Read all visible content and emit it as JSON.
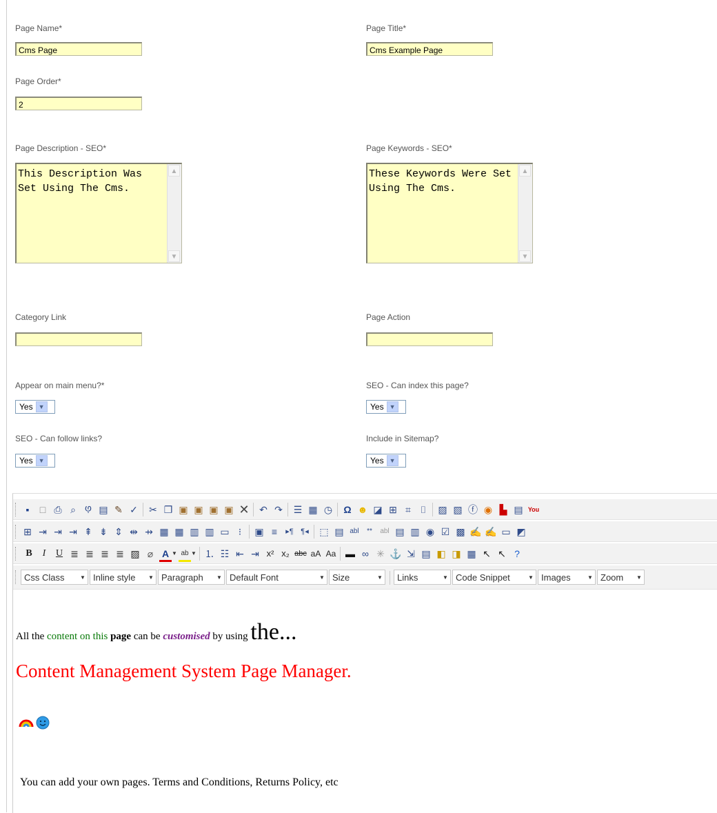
{
  "form": {
    "page_name": {
      "label": "Page Name*",
      "value": "Cms Page"
    },
    "page_title": {
      "label": "Page Title*",
      "value": "Cms Example Page"
    },
    "page_order": {
      "label": "Page Order*",
      "value": "2"
    },
    "page_description": {
      "label": "Page Description - SEO*",
      "value": "This Description Was Set Using The Cms."
    },
    "page_keywords": {
      "label": "Page Keywords - SEO*",
      "value": "These Keywords Were Set Using The Cms."
    },
    "category_link": {
      "label": "Category Link",
      "value": ""
    },
    "page_action": {
      "label": "Page Action",
      "value": ""
    },
    "appear_on_menu": {
      "label": "Appear on main menu?*",
      "value": "Yes"
    },
    "seo_index": {
      "label": "SEO - Can index this page?",
      "value": "Yes"
    },
    "seo_follow": {
      "label": "SEO - Can follow links?",
      "value": "Yes"
    },
    "include_sitemap": {
      "label": "Include in Sitemap?",
      "value": "Yes"
    }
  },
  "editor": {
    "dropdowns": {
      "css_class": "Css Class",
      "inline_style": "Inline style",
      "paragraph": "Paragraph",
      "font": "Default Font",
      "size": "Size",
      "links": "Links",
      "code_snippet": "Code Snippet",
      "images": "Images",
      "zoom": "Zoom"
    },
    "content": {
      "line1_a": "All the ",
      "line1_b": "content on this",
      "line1_c": " ",
      "line1_d": "page",
      "line1_e": " can be ",
      "line1_f": "customised",
      "line1_g": " by using ",
      "line1_h": "the...",
      "heading": "Content Management System Page Manager.",
      "footer_text": "You can add your own pages. Terms and Conditions, Returns Policy, etc"
    },
    "colors": {
      "green": "#0a7a0a",
      "purple": "#7a1f8a",
      "red": "#ff0000"
    }
  }
}
